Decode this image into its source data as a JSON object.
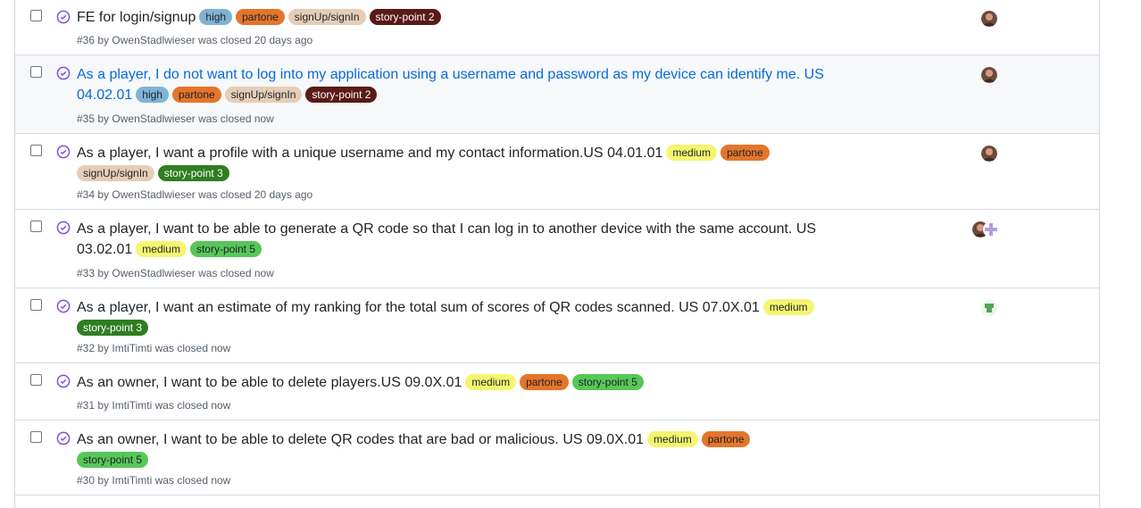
{
  "labels": {
    "high": {
      "text": "high",
      "bg": "#7fb3d5",
      "fg": "#1f2328"
    },
    "partone": {
      "text": "partone",
      "bg": "#e4752b",
      "fg": "#1f2328"
    },
    "signup": {
      "text": "signUp/signIn",
      "bg": "#e6cdb8",
      "fg": "#1f2328"
    },
    "sp2": {
      "text": "story-point 2",
      "bg": "#5a1a16",
      "fg": "#ffffff"
    },
    "medium": {
      "text": "medium",
      "bg": "#f5f571",
      "fg": "#1f2328"
    },
    "sp3": {
      "text": "story-point 3",
      "bg": "#2f7d21",
      "fg": "#ffffff"
    },
    "sp5": {
      "text": "story-point 5",
      "bg": "#57c758",
      "fg": "#1f2328"
    }
  },
  "issues": [
    {
      "title": "FE for login/signup",
      "labels": [
        "high",
        "partone",
        "signup",
        "sp2"
      ],
      "number": "#36",
      "by_text": "by",
      "author": "OwenStadlwieser",
      "closed": "was closed 20 days ago",
      "avatar": "user"
    },
    {
      "title": "As a player, I do not want to log into my application using a username and password as my device can identify me. US 04.02.01",
      "labels": [
        "high",
        "partone",
        "signup",
        "sp2"
      ],
      "number": "#35",
      "by_text": "by",
      "author": "OwenStadlwieser",
      "closed": "was closed now",
      "avatar": "user"
    },
    {
      "title": "As a player, I want a profile with a unique username and my contact information.US 04.01.01",
      "labels": [
        "medium",
        "partone",
        "signup",
        "sp3"
      ],
      "number": "#34",
      "by_text": "by",
      "author": "OwenStadlwieser",
      "closed": "was closed 20 days ago",
      "avatar": "user"
    },
    {
      "title": "As a player, I want to be able to generate a QR code so that I can log in to another device with the same account. US 03.02.01",
      "labels": [
        "medium",
        "sp5"
      ],
      "number": "#33",
      "by_text": "by",
      "author": "OwenStadlwieser",
      "closed": "was closed now",
      "avatar": "multi"
    },
    {
      "title": "As a player, I want an estimate of my ranking for the total sum of scores of QR codes scanned. US 07.0X.01",
      "labels": [
        "medium",
        "sp3"
      ],
      "number": "#32",
      "by_text": "by",
      "author": "ImtiTimti",
      "closed": "was closed now",
      "avatar": "green"
    },
    {
      "title": "As an owner, I want to be able to delete players.US 09.0X.01",
      "labels": [
        "medium",
        "partone",
        "sp5"
      ],
      "number": "#31",
      "by_text": "by",
      "author": "ImtiTimti",
      "closed": "was closed now",
      "avatar": "none"
    },
    {
      "title": "As an owner, I want to be able to delete QR codes that are bad or malicious. US 09.0X.01",
      "labels": [
        "medium",
        "partone",
        "sp5"
      ],
      "number": "#30",
      "by_text": "by",
      "author": "ImtiTimti",
      "closed": "was closed now",
      "avatar": "none"
    }
  ]
}
